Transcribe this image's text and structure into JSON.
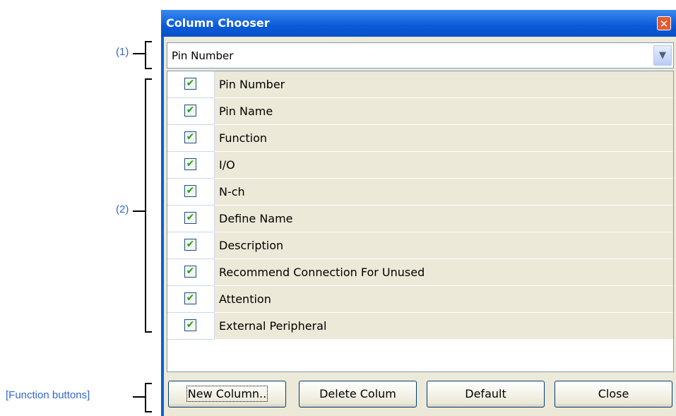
{
  "annotations": {
    "dropdown": "(1)",
    "list": "(2)",
    "buttons": "[Function buttons]"
  },
  "window": {
    "title": "Column Chooser",
    "close_icon": "close-x-icon"
  },
  "dropdown": {
    "value": "Pin Number",
    "arrow_icon": "chevron-down-icon"
  },
  "list": {
    "items": [
      {
        "label": "Pin Number",
        "checked": true
      },
      {
        "label": "Pin Name",
        "checked": true
      },
      {
        "label": "Function",
        "checked": true
      },
      {
        "label": "I/O",
        "checked": true
      },
      {
        "label": "N-ch",
        "checked": true
      },
      {
        "label": "Define Name",
        "checked": true
      },
      {
        "label": "Description",
        "checked": true
      },
      {
        "label": "Recommend Connection For Unused",
        "checked": true
      },
      {
        "label": "Attention",
        "checked": true
      },
      {
        "label": "External Peripheral",
        "checked": true
      }
    ]
  },
  "buttons": {
    "new_column": "New Column..",
    "delete_column": "Delete Colum",
    "default": "Default",
    "close": "Close"
  },
  "colors": {
    "titlebar": "#0a5ad8",
    "annotation": "#3366cc",
    "check": "#21a121"
  }
}
